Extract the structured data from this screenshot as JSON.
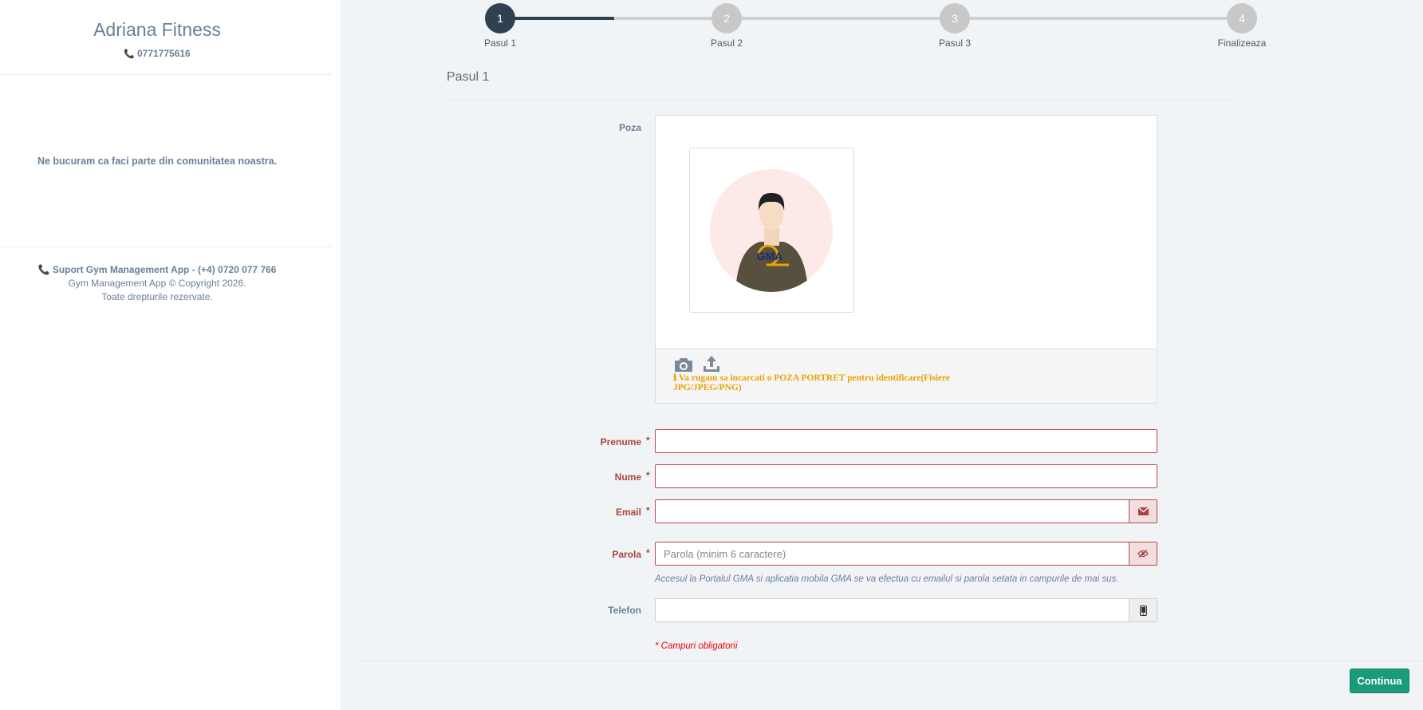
{
  "sidebar": {
    "gym_name": "Adriana Fitness",
    "phone": "0771775616",
    "welcome": "Ne bucuram ca faci parte din comunitatea noastra.",
    "support": "Suport Gym Management App - (+4) 0720 077 766",
    "copyright": "Gym Management App © Copyright 2026.",
    "rights": "Toate drepturile rezervate."
  },
  "stepper": {
    "current": 1,
    "steps": [
      {
        "number": "1",
        "label": "Pasul 1"
      },
      {
        "number": "2",
        "label": "Pasul 2"
      },
      {
        "number": "3",
        "label": "Pasul 3"
      },
      {
        "number": "4",
        "label": "Finalizeaza"
      }
    ]
  },
  "form": {
    "section_title": "Pasul 1",
    "photo": {
      "label": "Poza",
      "avatar_logo": "GMA",
      "note": "Va rugam sa incarcati o POZA PORTRET pentru identificare(Fisiere JPG/JPEG/PNG)"
    },
    "fields": {
      "first_name": {
        "label": "Prenume",
        "value": "",
        "required": true
      },
      "last_name": {
        "label": "Nume",
        "value": "",
        "required": true
      },
      "email": {
        "label": "Email",
        "value": "",
        "required": true
      },
      "password": {
        "label": "Parola",
        "value": "",
        "placeholder": "Parola (minim 6 caractere)",
        "required": true
      },
      "phone": {
        "label": "Telefon",
        "value": "",
        "required": false
      }
    },
    "required_mark": "*",
    "hint": "Accesul la Portalul GMA si aplicatia mobila GMA se va efectua cu emailul si parola setata in campurile de mai sus.",
    "required_note": "* Campuri obligatorii"
  },
  "actions": {
    "continue_label": "Continua"
  },
  "colors": {
    "accent": "#2f4050",
    "error": "#a94442",
    "button": "#1a9b7a",
    "warning": "#e8a400"
  }
}
